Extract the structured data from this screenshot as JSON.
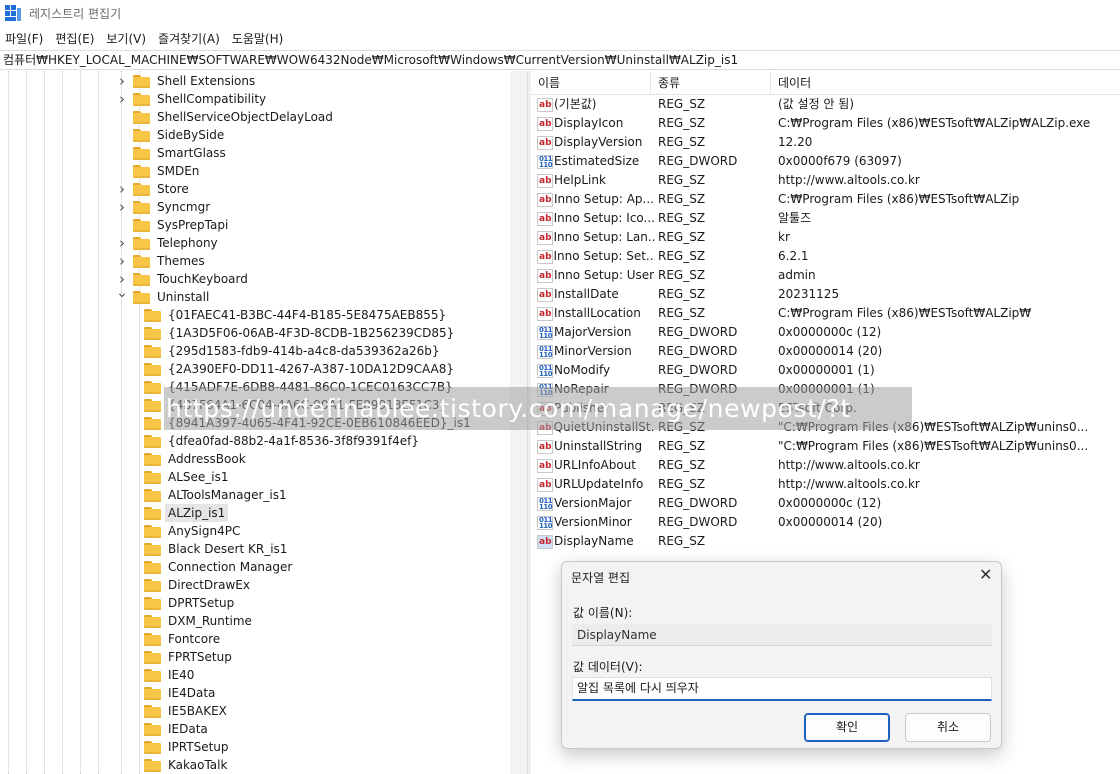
{
  "window": {
    "title": "레지스트리 편집기"
  },
  "menu": [
    "파일(F)",
    "편집(E)",
    "보기(V)",
    "즐겨찾기(A)",
    "도움말(H)"
  ],
  "address": "컴퓨터₩HKEY_LOCAL_MACHINE₩SOFTWARE₩WOW6432Node₩Microsoft₩Windows₩CurrentVersion₩Uninstall₩ALZip_is1",
  "tree": {
    "items_level1": [
      {
        "label": "Shell Extensions",
        "expander": "collapsed"
      },
      {
        "label": "ShellCompatibility",
        "expander": "collapsed"
      },
      {
        "label": "ShellServiceObjectDelayLoad",
        "expander": "none"
      },
      {
        "label": "SideBySide",
        "expander": "none"
      },
      {
        "label": "SmartGlass",
        "expander": "none"
      },
      {
        "label": "SMDEn",
        "expander": "none"
      },
      {
        "label": "Store",
        "expander": "collapsed"
      },
      {
        "label": "Syncmgr",
        "expander": "collapsed"
      },
      {
        "label": "SysPrepTapi",
        "expander": "none"
      },
      {
        "label": "Telephony",
        "expander": "collapsed"
      },
      {
        "label": "Themes",
        "expander": "collapsed"
      },
      {
        "label": "TouchKeyboard",
        "expander": "collapsed"
      },
      {
        "label": "Uninstall",
        "expander": "expanded"
      }
    ],
    "items_level2": [
      {
        "label": "{01FAEC41-B3BC-44F4-B185-5E8475AEB855}"
      },
      {
        "label": "{1A3D5F06-06AB-4F3D-8CDB-1B256239CD85}"
      },
      {
        "label": "{295d1583-fdb9-414b-a4c8-da539362a26b}"
      },
      {
        "label": "{2A390EF0-DD11-4267-A387-10DA12D9CAA8}"
      },
      {
        "label": "{415ADF7E-6DB8-4481-86C0-1CEC0163CC7B}"
      },
      {
        "label": "{4B7F64A1-6C04-4A6C-90A1-FE89918EF1C3}"
      },
      {
        "label": "{8941A397-4065-4F41-92CE-0EB610846EED}_is1"
      },
      {
        "label": "{dfea0fad-88b2-4a1f-8536-3f8f9391f4ef}"
      },
      {
        "label": "AddressBook"
      },
      {
        "label": "ALSee_is1"
      },
      {
        "label": "ALToolsManager_is1"
      },
      {
        "label": "ALZip_is1",
        "selected": true
      },
      {
        "label": "AnySign4PC"
      },
      {
        "label": "Black Desert KR_is1"
      },
      {
        "label": "Connection Manager"
      },
      {
        "label": "DirectDrawEx"
      },
      {
        "label": "DPRTSetup"
      },
      {
        "label": "DXM_Runtime"
      },
      {
        "label": "Fontcore"
      },
      {
        "label": "FPRTSetup"
      },
      {
        "label": "IE40"
      },
      {
        "label": "IE4Data"
      },
      {
        "label": "IE5BAKEX"
      },
      {
        "label": "IEData"
      },
      {
        "label": "IPRTSetup"
      },
      {
        "label": "KakaoTalk"
      }
    ]
  },
  "list": {
    "headers": {
      "name": "이름",
      "type": "종류",
      "data": "데이터"
    },
    "rows": [
      {
        "icon": "ab",
        "name": "(기본값)",
        "type": "REG_SZ",
        "data": "(값 설정 안 됨)"
      },
      {
        "icon": "ab",
        "name": "DisplayIcon",
        "type": "REG_SZ",
        "data": "C:₩Program Files (x86)₩ESTsoft₩ALZip₩ALZip.exe"
      },
      {
        "icon": "ab",
        "name": "DisplayVersion",
        "type": "REG_SZ",
        "data": "12.20"
      },
      {
        "icon": "bin",
        "name": "EstimatedSize",
        "type": "REG_DWORD",
        "data": "0x0000f679 (63097)"
      },
      {
        "icon": "ab",
        "name": "HelpLink",
        "type": "REG_SZ",
        "data": "http://www.altools.co.kr"
      },
      {
        "icon": "ab",
        "name": "Inno Setup: Ap...",
        "type": "REG_SZ",
        "data": "C:₩Program Files (x86)₩ESTsoft₩ALZip"
      },
      {
        "icon": "ab",
        "name": "Inno Setup: Ico...",
        "type": "REG_SZ",
        "data": "알툴즈"
      },
      {
        "icon": "ab",
        "name": "Inno Setup: Lan...",
        "type": "REG_SZ",
        "data": "kr"
      },
      {
        "icon": "ab",
        "name": "Inno Setup: Set...",
        "type": "REG_SZ",
        "data": "6.2.1"
      },
      {
        "icon": "ab",
        "name": "Inno Setup: User",
        "type": "REG_SZ",
        "data": "admin"
      },
      {
        "icon": "ab",
        "name": "InstallDate",
        "type": "REG_SZ",
        "data": "20231125"
      },
      {
        "icon": "ab",
        "name": "InstallLocation",
        "type": "REG_SZ",
        "data": "C:₩Program Files (x86)₩ESTsoft₩ALZip₩"
      },
      {
        "icon": "bin",
        "name": "MajorVersion",
        "type": "REG_DWORD",
        "data": "0x0000000c (12)"
      },
      {
        "icon": "bin",
        "name": "MinorVersion",
        "type": "REG_DWORD",
        "data": "0x00000014 (20)"
      },
      {
        "icon": "bin",
        "name": "NoModify",
        "type": "REG_DWORD",
        "data": "0x00000001 (1)"
      },
      {
        "icon": "bin",
        "name": "NoRepair",
        "type": "REG_DWORD",
        "data": "0x00000001 (1)"
      },
      {
        "icon": "ab",
        "name": "Publisher",
        "type": "REG_SZ",
        "data": "ESTsoft Corp."
      },
      {
        "icon": "ab",
        "name": "QuietUninstallSt...",
        "type": "REG_SZ",
        "data": "\"C:₩Program Files (x86)₩ESTsoft₩ALZip₩unins0..."
      },
      {
        "icon": "ab",
        "name": "UninstallString",
        "type": "REG_SZ",
        "data": "\"C:₩Program Files (x86)₩ESTsoft₩ALZip₩unins0..."
      },
      {
        "icon": "ab",
        "name": "URLInfoAbout",
        "type": "REG_SZ",
        "data": "http://www.altools.co.kr"
      },
      {
        "icon": "ab",
        "name": "URLUpdateInfo",
        "type": "REG_SZ",
        "data": "http://www.altools.co.kr"
      },
      {
        "icon": "bin",
        "name": "VersionMajor",
        "type": "REG_DWORD",
        "data": "0x0000000c (12)"
      },
      {
        "icon": "bin",
        "name": "VersionMinor",
        "type": "REG_DWORD",
        "data": "0x00000014 (20)"
      },
      {
        "icon": "ab",
        "name": "DisplayName",
        "type": "REG_SZ",
        "data": ""
      }
    ]
  },
  "watermark": "https://undefinablee.tistory.com/manage/newpost/?t",
  "dialog": {
    "title": "문자열 편집",
    "value_name_label": "값 이름(N):",
    "value_name": "DisplayName",
    "value_data_label": "값 데이터(V):",
    "value_data": "알집 목록에 다시 띄우자",
    "ok_label": "확인",
    "cancel_label": "취소"
  },
  "colors": {
    "accent": "#1f5fbf",
    "folder": "#f8c647",
    "selection": "#e5e5e5"
  }
}
